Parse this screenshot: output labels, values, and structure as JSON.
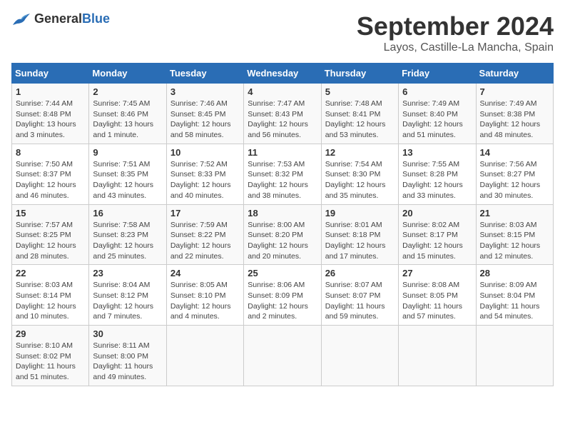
{
  "header": {
    "logo_general": "General",
    "logo_blue": "Blue",
    "title": "September 2024",
    "location": "Layos, Castille-La Mancha, Spain"
  },
  "columns": [
    "Sunday",
    "Monday",
    "Tuesday",
    "Wednesday",
    "Thursday",
    "Friday",
    "Saturday"
  ],
  "weeks": [
    [
      {
        "day": "1",
        "detail": "Sunrise: 7:44 AM\nSunset: 8:48 PM\nDaylight: 13 hours\nand 3 minutes."
      },
      {
        "day": "2",
        "detail": "Sunrise: 7:45 AM\nSunset: 8:46 PM\nDaylight: 13 hours\nand 1 minute."
      },
      {
        "day": "3",
        "detail": "Sunrise: 7:46 AM\nSunset: 8:45 PM\nDaylight: 12 hours\nand 58 minutes."
      },
      {
        "day": "4",
        "detail": "Sunrise: 7:47 AM\nSunset: 8:43 PM\nDaylight: 12 hours\nand 56 minutes."
      },
      {
        "day": "5",
        "detail": "Sunrise: 7:48 AM\nSunset: 8:41 PM\nDaylight: 12 hours\nand 53 minutes."
      },
      {
        "day": "6",
        "detail": "Sunrise: 7:49 AM\nSunset: 8:40 PM\nDaylight: 12 hours\nand 51 minutes."
      },
      {
        "day": "7",
        "detail": "Sunrise: 7:49 AM\nSunset: 8:38 PM\nDaylight: 12 hours\nand 48 minutes."
      }
    ],
    [
      {
        "day": "8",
        "detail": "Sunrise: 7:50 AM\nSunset: 8:37 PM\nDaylight: 12 hours\nand 46 minutes."
      },
      {
        "day": "9",
        "detail": "Sunrise: 7:51 AM\nSunset: 8:35 PM\nDaylight: 12 hours\nand 43 minutes."
      },
      {
        "day": "10",
        "detail": "Sunrise: 7:52 AM\nSunset: 8:33 PM\nDaylight: 12 hours\nand 40 minutes."
      },
      {
        "day": "11",
        "detail": "Sunrise: 7:53 AM\nSunset: 8:32 PM\nDaylight: 12 hours\nand 38 minutes."
      },
      {
        "day": "12",
        "detail": "Sunrise: 7:54 AM\nSunset: 8:30 PM\nDaylight: 12 hours\nand 35 minutes."
      },
      {
        "day": "13",
        "detail": "Sunrise: 7:55 AM\nSunset: 8:28 PM\nDaylight: 12 hours\nand 33 minutes."
      },
      {
        "day": "14",
        "detail": "Sunrise: 7:56 AM\nSunset: 8:27 PM\nDaylight: 12 hours\nand 30 minutes."
      }
    ],
    [
      {
        "day": "15",
        "detail": "Sunrise: 7:57 AM\nSunset: 8:25 PM\nDaylight: 12 hours\nand 28 minutes."
      },
      {
        "day": "16",
        "detail": "Sunrise: 7:58 AM\nSunset: 8:23 PM\nDaylight: 12 hours\nand 25 minutes."
      },
      {
        "day": "17",
        "detail": "Sunrise: 7:59 AM\nSunset: 8:22 PM\nDaylight: 12 hours\nand 22 minutes."
      },
      {
        "day": "18",
        "detail": "Sunrise: 8:00 AM\nSunset: 8:20 PM\nDaylight: 12 hours\nand 20 minutes."
      },
      {
        "day": "19",
        "detail": "Sunrise: 8:01 AM\nSunset: 8:18 PM\nDaylight: 12 hours\nand 17 minutes."
      },
      {
        "day": "20",
        "detail": "Sunrise: 8:02 AM\nSunset: 8:17 PM\nDaylight: 12 hours\nand 15 minutes."
      },
      {
        "day": "21",
        "detail": "Sunrise: 8:03 AM\nSunset: 8:15 PM\nDaylight: 12 hours\nand 12 minutes."
      }
    ],
    [
      {
        "day": "22",
        "detail": "Sunrise: 8:03 AM\nSunset: 8:14 PM\nDaylight: 12 hours\nand 10 minutes."
      },
      {
        "day": "23",
        "detail": "Sunrise: 8:04 AM\nSunset: 8:12 PM\nDaylight: 12 hours\nand 7 minutes."
      },
      {
        "day": "24",
        "detail": "Sunrise: 8:05 AM\nSunset: 8:10 PM\nDaylight: 12 hours\nand 4 minutes."
      },
      {
        "day": "25",
        "detail": "Sunrise: 8:06 AM\nSunset: 8:09 PM\nDaylight: 12 hours\nand 2 minutes."
      },
      {
        "day": "26",
        "detail": "Sunrise: 8:07 AM\nSunset: 8:07 PM\nDaylight: 11 hours\nand 59 minutes."
      },
      {
        "day": "27",
        "detail": "Sunrise: 8:08 AM\nSunset: 8:05 PM\nDaylight: 11 hours\nand 57 minutes."
      },
      {
        "day": "28",
        "detail": "Sunrise: 8:09 AM\nSunset: 8:04 PM\nDaylight: 11 hours\nand 54 minutes."
      }
    ],
    [
      {
        "day": "29",
        "detail": "Sunrise: 8:10 AM\nSunset: 8:02 PM\nDaylight: 11 hours\nand 51 minutes."
      },
      {
        "day": "30",
        "detail": "Sunrise: 8:11 AM\nSunset: 8:00 PM\nDaylight: 11 hours\nand 49 minutes."
      },
      {
        "day": "",
        "detail": ""
      },
      {
        "day": "",
        "detail": ""
      },
      {
        "day": "",
        "detail": ""
      },
      {
        "day": "",
        "detail": ""
      },
      {
        "day": "",
        "detail": ""
      }
    ]
  ]
}
